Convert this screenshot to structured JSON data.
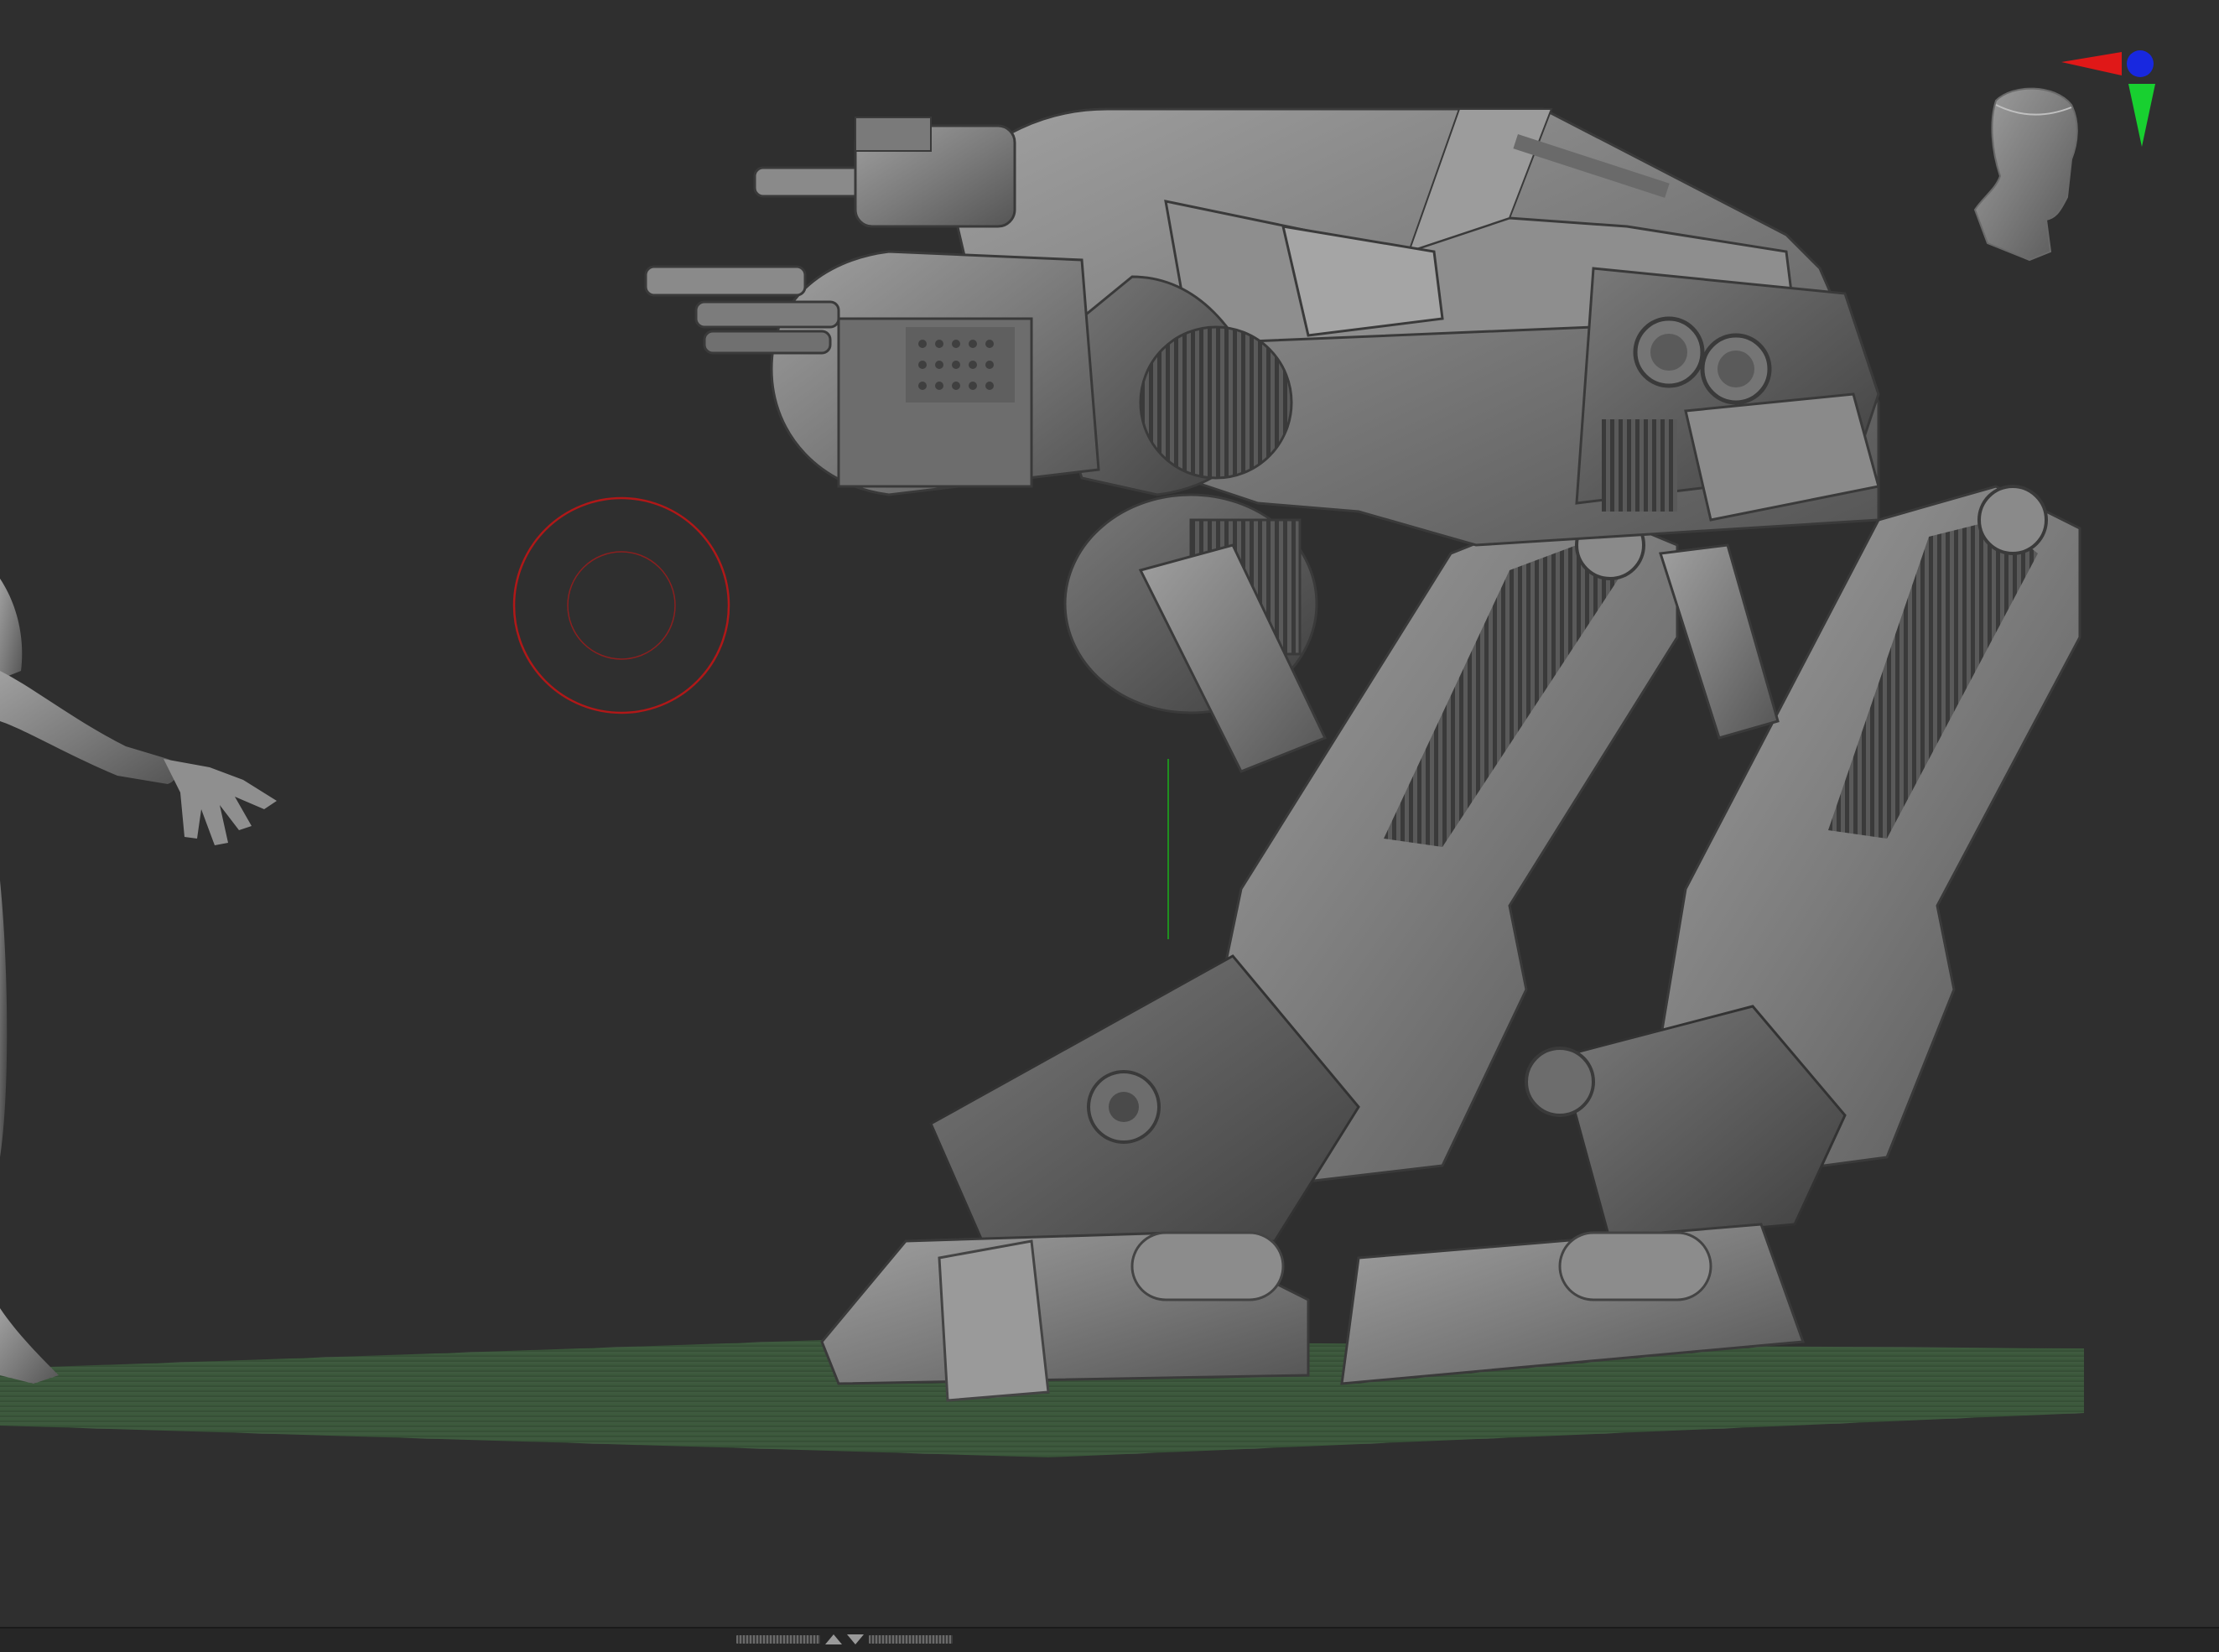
{
  "app": {
    "title": ""
  },
  "viewport": {
    "background_color": "#2f2f2f",
    "floor_color": "#3d5a3d",
    "model_color": "#8a8a8a",
    "model_shadow": "#4d4d4d",
    "brush_ring_color": "#b01818"
  },
  "gyro": {
    "x_axis_color": "#e01818",
    "y_axis_color": "#18d030",
    "z_axis_color": "#1828e0"
  },
  "icons": {
    "brush_cursor": "brush-cursor-icon",
    "navigation_head": "head-gizmo-icon",
    "shelf_toggle": "chevron-up-down-icon"
  }
}
